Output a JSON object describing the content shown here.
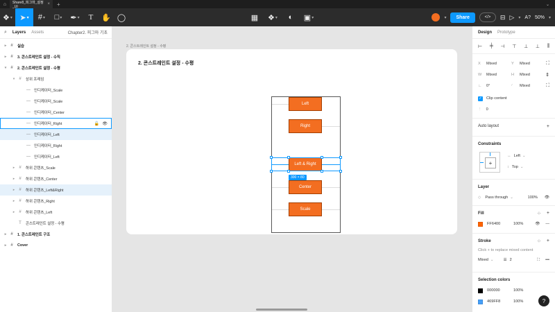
{
  "tabbar": {
    "tab_label": "Share8_피그마_설정_UI"
  },
  "toolbar": {
    "share_label": "Share",
    "zoom": "50%"
  },
  "left": {
    "tab_layers": "Layers",
    "tab_assets": "Assets",
    "page_name": "Chapter2. 피그마 기초",
    "layers": [
      {
        "label": "실습",
        "icon": "#",
        "arrow": "▸"
      },
      {
        "label": "3. 콘스트레인트 설정 - 수직",
        "icon": "#",
        "arrow": "▸"
      },
      {
        "label": "2. 콘스트레인트 설정 - 수평",
        "icon": "#",
        "arrow": "▾"
      },
      {
        "label": "상위 프레임",
        "icon": "#",
        "arrow": "▾"
      },
      {
        "label": "인디케이터_Scale",
        "icon": "—",
        "arrow": ""
      },
      {
        "label": "인디케이터_Scale",
        "icon": "—",
        "arrow": ""
      },
      {
        "label": "인디케이터_Center",
        "icon": "—",
        "arrow": ""
      },
      {
        "label": "인디케이터_Right",
        "icon": "—",
        "arrow": ""
      },
      {
        "label": "인디케이터_Left",
        "icon": "—",
        "arrow": ""
      },
      {
        "label": "인디케이터_Right",
        "icon": "—",
        "arrow": ""
      },
      {
        "label": "인디케이터_Left",
        "icon": "—",
        "arrow": ""
      },
      {
        "label": "하위 콘텐츠_Scale",
        "icon": "#",
        "arrow": "▸"
      },
      {
        "label": "하위 콘텐츠_Center",
        "icon": "#",
        "arrow": "▸"
      },
      {
        "label": "하위 콘텐츠_Left&Right",
        "icon": "#",
        "arrow": "▸"
      },
      {
        "label": "하위 콘텐츠_Right",
        "icon": "#",
        "arrow": "▸"
      },
      {
        "label": "하위 콘텐츠_Left",
        "icon": "#",
        "arrow": "▸"
      },
      {
        "label": "콘스트레인트 설정 - 수평",
        "icon": "T",
        "arrow": ""
      },
      {
        "label": "1. 콘스트레인트 구조",
        "icon": "#",
        "arrow": "▸"
      },
      {
        "label": "Cover",
        "icon": "#",
        "arrow": "▸"
      }
    ]
  },
  "canvas": {
    "frame_label": "2. 콘스트레인트 설정 - 수평",
    "frame_title": "2. 콘스트레인트 설정 - 수평",
    "boxes": [
      "Left",
      "Right",
      "Left & Right",
      "Center",
      "Scale"
    ],
    "size_badge": "300 × 80"
  },
  "right": {
    "tab_design": "Design",
    "tab_prototype": "Prototype",
    "x_label": "X",
    "x_value": "Mixed",
    "y_label": "Y",
    "y_value": "Mixed",
    "w_label": "W",
    "w_value": "Mixed",
    "h_label": "H",
    "h_value": "Mixed",
    "rotation": "0°",
    "radius": "Mixed",
    "clip_content": "Clip content",
    "spacing": "0",
    "auto_layout": "Auto layout",
    "constraints_title": "Constraints",
    "constraint_h": "Left",
    "constraint_v": "Top",
    "layer_title": "Layer",
    "blend_mode": "Pass through",
    "layer_opacity": "100%",
    "fill_title": "Fill",
    "fill_hex": "FF6400",
    "fill_opacity": "100%",
    "stroke_title": "Stroke",
    "stroke_hint": "Click + to replace mixed content",
    "stroke_mode": "Mixed",
    "stroke_weight": "2",
    "selection_colors_title": "Selection colors",
    "sel_colors": [
      {
        "hex": "000000",
        "opacity": "100%"
      },
      {
        "hex": "469FF8",
        "opacity": "100%"
      }
    ]
  },
  "colors": {
    "accent": "#0d99ff",
    "orange": "#f36e21",
    "fill_swatch": "#ff6400",
    "swatch_black": "#000000",
    "swatch_blue": "#469ff8"
  }
}
